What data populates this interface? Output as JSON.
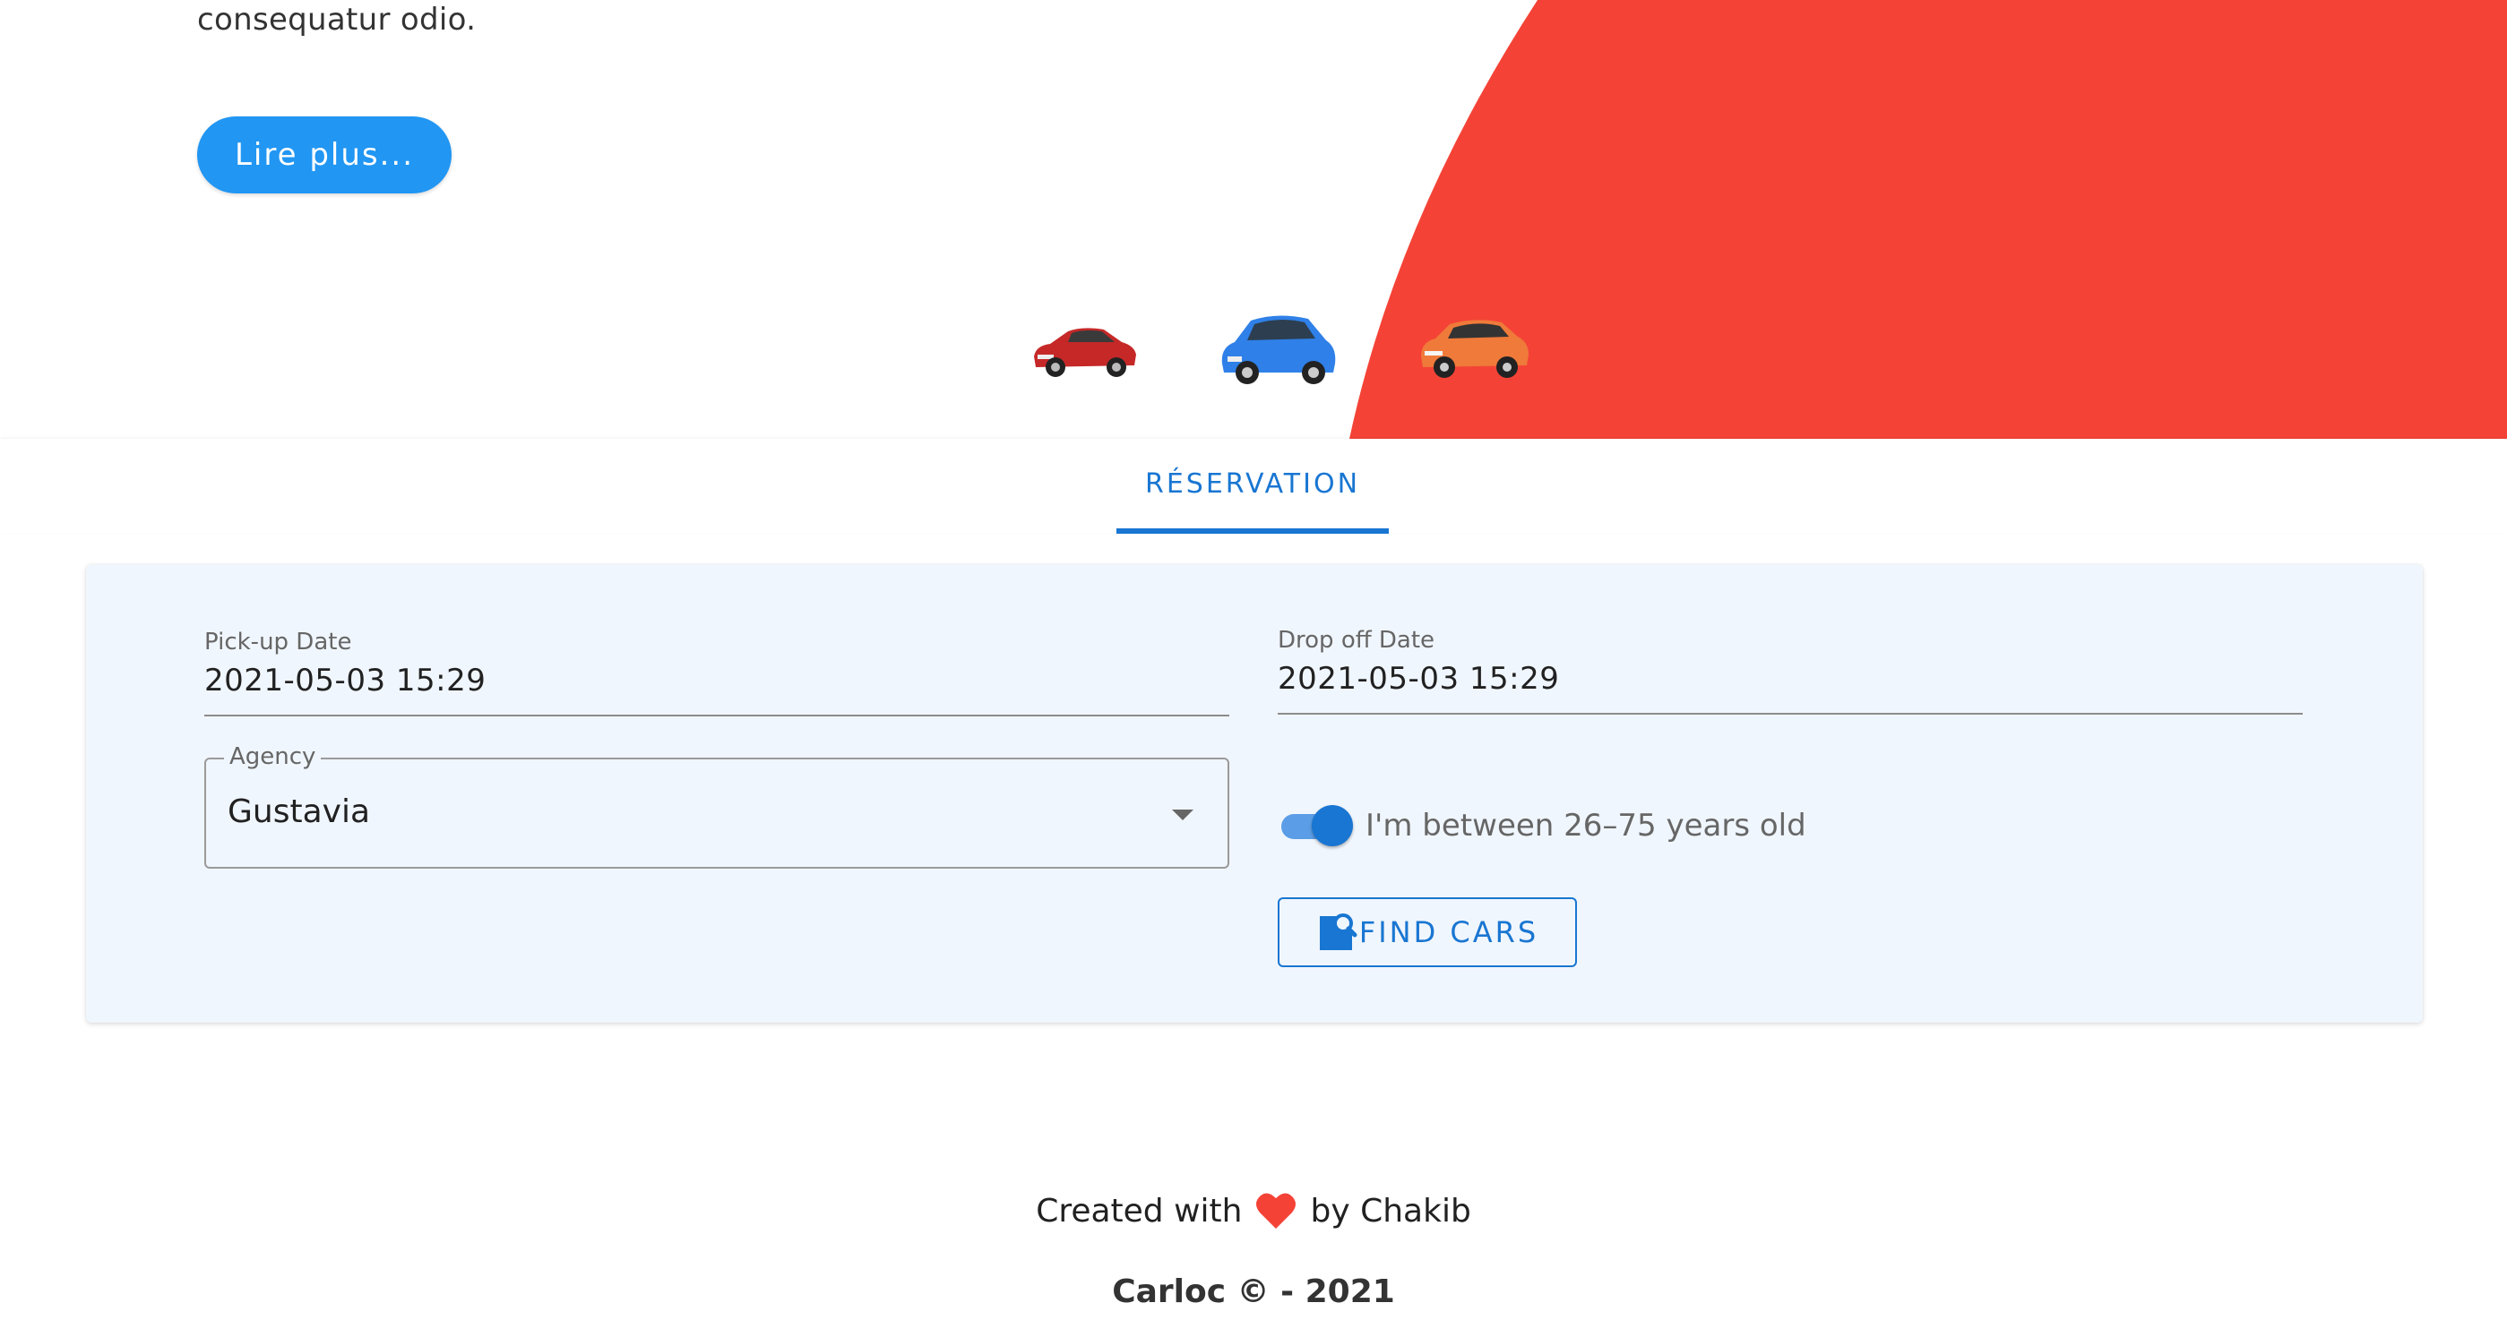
{
  "hero": {
    "text": "consequatur odio.",
    "read_more_label": "Lire plus...",
    "accent_color": "#f44336",
    "cars": [
      "red-sedan",
      "blue-hatchback",
      "orange-suv"
    ]
  },
  "tabs": [
    {
      "label": "RÉSERVATION",
      "active": true
    }
  ],
  "reservation": {
    "pickup": {
      "label": "Pick-up Date",
      "value": "2021-05-03 15:29"
    },
    "dropoff": {
      "label": "Drop off Date",
      "value": "2021-05-03 15:29"
    },
    "agency": {
      "label": "Agency",
      "value": "Gustavia"
    },
    "age_toggle": {
      "label": "I'm between 26–75 years old",
      "checked": true
    },
    "find_button_label": "FIND CARS",
    "primary_color": "#1976d2"
  },
  "footer": {
    "created_prefix": "Created with",
    "created_suffix": "by Chakib",
    "copyright": "Carloc © - 2021"
  }
}
